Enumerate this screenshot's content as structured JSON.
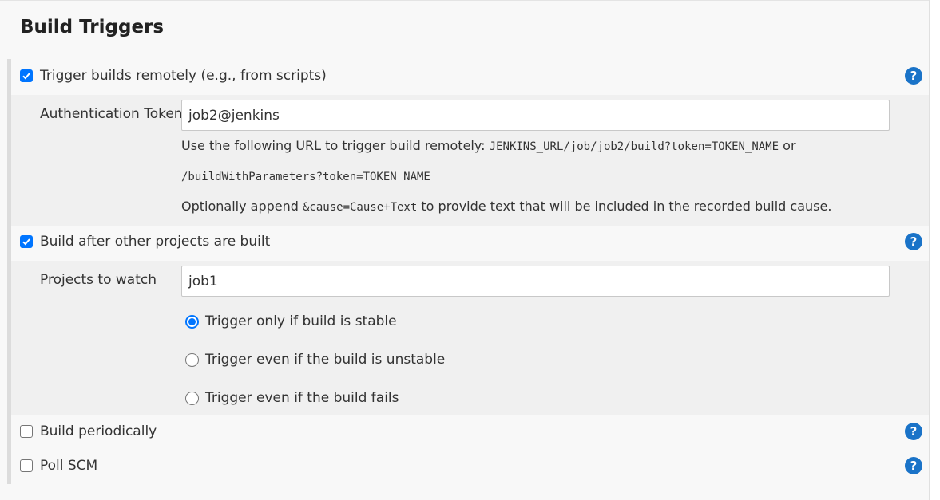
{
  "section": {
    "title": "Build Triggers"
  },
  "triggers": [
    {
      "label": "Trigger builds remotely (e.g., from scripts)",
      "checked": true,
      "help_icon": "question-circle-icon"
    },
    {
      "label": "Build after other projects are built",
      "checked": true,
      "help_icon": "question-circle-icon"
    },
    {
      "label": "Build periodically",
      "checked": false,
      "help_icon": "question-circle-icon"
    },
    {
      "label": "Poll SCM",
      "checked": false,
      "help_icon": "question-circle-icon"
    }
  ],
  "help_glyph": "?",
  "remote": {
    "token_label": "Authentication Token",
    "token_value": "job2@jenkins",
    "url_prefix": "Use the following URL to trigger build remotely: ",
    "url_code": "JENKINS_URL/job/job2/build?token=TOKEN_NAME",
    "url_or": " or",
    "url_alt": "/buildWithParameters?token=TOKEN_NAME",
    "cause_prefix": "Optionally append ",
    "cause_code": "&cause=Cause+Text",
    "cause_suffix": " to provide text that will be included in the recorded build cause."
  },
  "upstream": {
    "projects_label": "Projects to watch",
    "projects_value": "job1",
    "options": [
      {
        "label": "Trigger only if build is stable",
        "selected": true
      },
      {
        "label": "Trigger even if the build is unstable",
        "selected": false
      },
      {
        "label": "Trigger even if the build fails",
        "selected": false
      }
    ]
  },
  "colors": {
    "accent": "#0075ff",
    "help_icon": "#1a73c8",
    "panel_bg": "#f8f8f8",
    "nested_bg": "#f0f0f0"
  }
}
